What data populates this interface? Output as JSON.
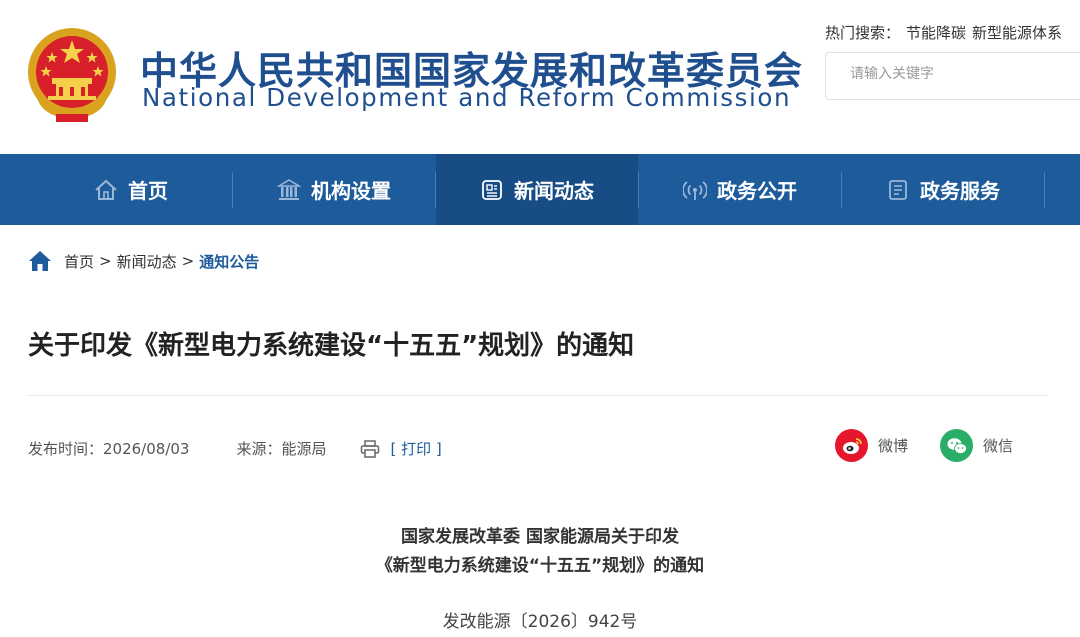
{
  "header": {
    "title_cn": "中华人民共和国国家发展和改革委员会",
    "title_en": "National Development and Reform Commission",
    "emblem_icon": "national-emblem-icon",
    "hot_search_label": "热门搜索：",
    "hot_search_items": [
      "节能降碳",
      "新型能源体系"
    ],
    "search_placeholder": "请输入关键字"
  },
  "nav": {
    "items": [
      {
        "label": "首页",
        "icon": "home-icon"
      },
      {
        "label": "机构设置",
        "icon": "building-icon"
      },
      {
        "label": "新闻动态",
        "icon": "news-icon",
        "active": true
      },
      {
        "label": "政务公开",
        "icon": "broadcast-icon"
      },
      {
        "label": "政务服务",
        "icon": "document-icon"
      }
    ]
  },
  "breadcrumb": {
    "items": [
      "首页",
      "新闻动态",
      "通知公告"
    ],
    "separator": ">"
  },
  "article": {
    "title": "关于印发《新型电力系统建设“十五五”规划》的通知",
    "date_label": "发布时间：2026/08/03",
    "source_label": "来源：能源局",
    "print_label": "[ 打印 ]",
    "share": [
      {
        "label": "微博",
        "icon": "weibo-icon"
      },
      {
        "label": "微信",
        "icon": "wechat-icon"
      }
    ],
    "body_heading_line1": "国家发展改革委 国家能源局关于印发",
    "body_heading_line2": "《新型电力系统建设“十五五”规划》的通知",
    "doc_number": "发改能源〔2026〕942号"
  },
  "colors": {
    "brand_blue": "#1d5b9b",
    "nav_active": "#174c84",
    "weibo_red": "#e6162d",
    "wechat_green": "#2aae67"
  }
}
